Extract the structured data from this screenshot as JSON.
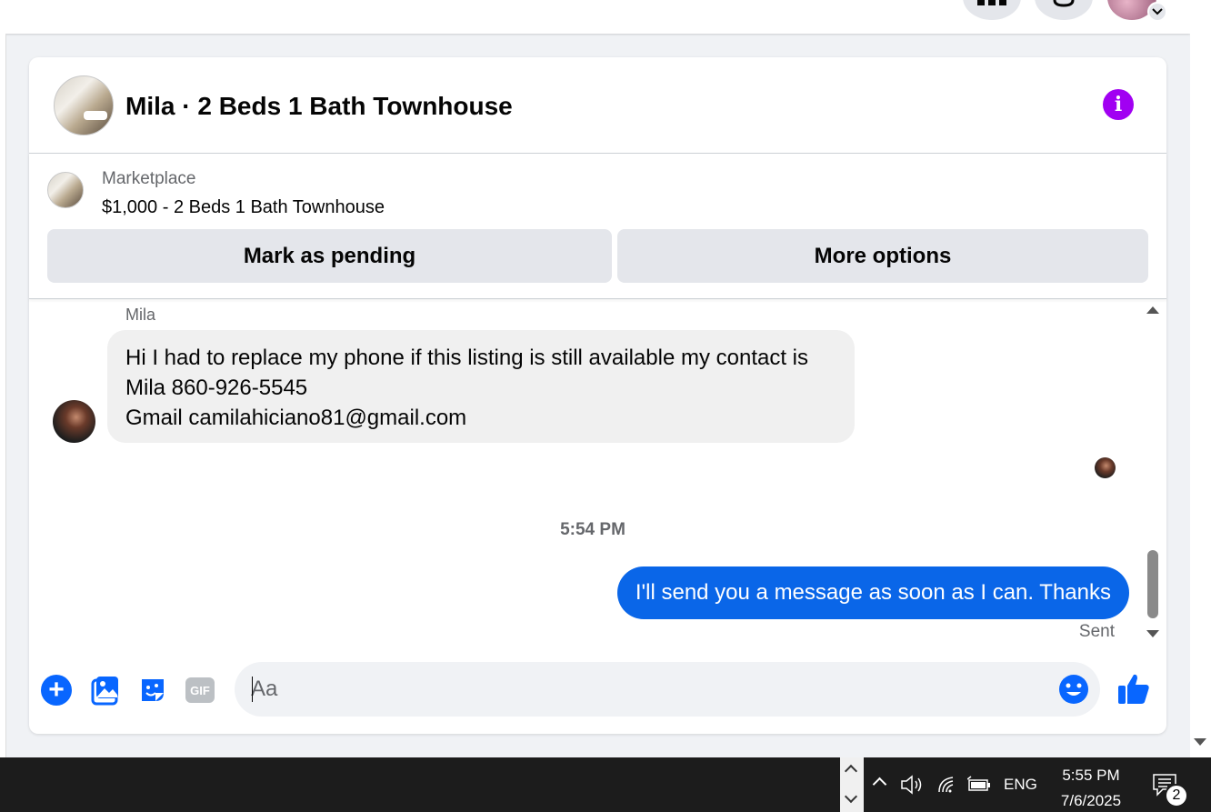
{
  "conversation": {
    "title": "Mila · 2 Beds 1 Bath Townhouse"
  },
  "listing": {
    "source": "Marketplace",
    "title": "$1,000 - 2 Beds 1 Bath Townhouse",
    "mark_pending_label": "Mark as pending",
    "more_options_label": "More options"
  },
  "messages": {
    "incoming": {
      "sender": "Mila",
      "lines": [
        "Hi I had to replace my phone if this listing is still available my contact is",
        "Mila 860-926-5545",
        "Gmail camilahiciano81@gmail.com"
      ]
    },
    "timestamp": "5:54 PM",
    "outgoing": {
      "text": "I'll send you a message as soon as I can. Thanks",
      "status": "Sent"
    }
  },
  "composer": {
    "placeholder": "Aa",
    "value": "",
    "gif_label": "GIF"
  },
  "taskbar": {
    "language": "ENG",
    "time": "5:55 PM",
    "date": "7/6/2025",
    "notification_count": "2"
  },
  "colors": {
    "accent_blue": "#0866ff",
    "outgoing_bubble": "#0a66e8",
    "info_purple": "#a100f2",
    "incoming_bubble": "#f0f0f0"
  }
}
